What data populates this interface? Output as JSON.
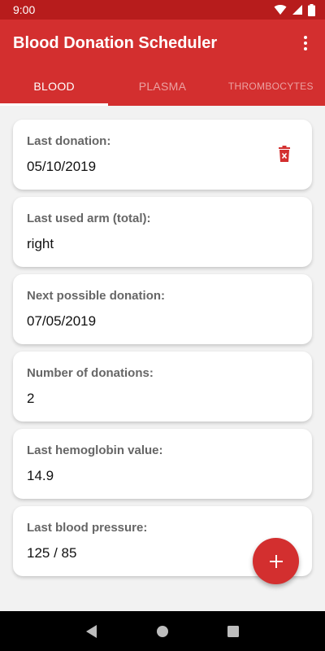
{
  "status_bar": {
    "time": "9:00"
  },
  "app_bar": {
    "title": "Blood Donation Scheduler"
  },
  "tabs": [
    {
      "label": "BLOOD",
      "active": true
    },
    {
      "label": "PLASMA",
      "active": false
    },
    {
      "label": "THROMBOCYTES",
      "active": false
    }
  ],
  "cards": [
    {
      "label": "Last donation:",
      "value": "05/10/2019"
    },
    {
      "label": "Last used arm (total):",
      "value": "right"
    },
    {
      "label": "Next possible donation:",
      "value": "07/05/2019"
    },
    {
      "label": "Number of donations:",
      "value": "2"
    },
    {
      "label": "Last hemoglobin value:",
      "value": "14.9"
    },
    {
      "label": "Last blood pressure:",
      "value": "125 / 85"
    }
  ],
  "colors": {
    "primary": "#d32f2f",
    "status_bar": "#b71c1c",
    "background": "#f2f2f2"
  },
  "icons": {
    "delete": "trash-icon",
    "fab": "plus-icon",
    "overflow": "more-vert-icon"
  }
}
